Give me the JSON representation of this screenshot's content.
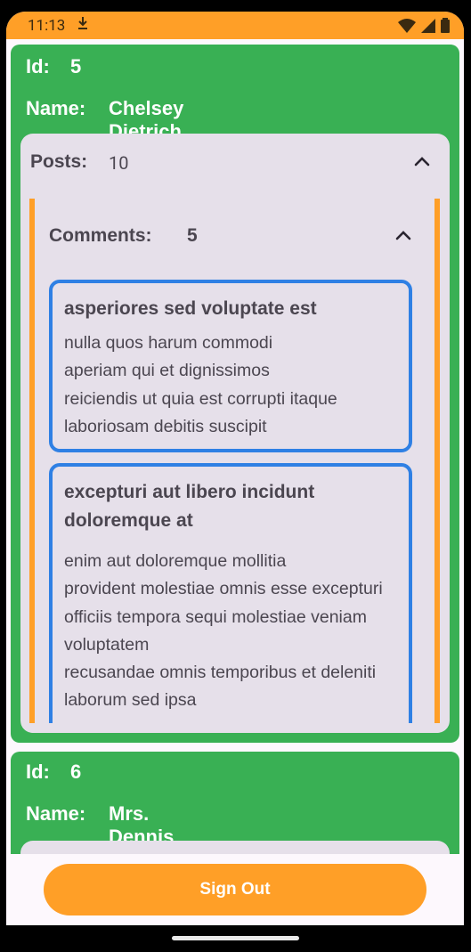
{
  "status": {
    "time": "11:13"
  },
  "users": [
    {
      "id_label": "Id:",
      "id": "5",
      "name_label": "Name:",
      "name": "Chelsey Dietrich",
      "posts_label": "Posts:",
      "posts_count": "10",
      "comments_label": "Comments:",
      "comments_count": "5",
      "comments": [
        {
          "title": "asperiores sed voluptate est",
          "body": "nulla quos harum commodi\naperiam qui et dignissimos\nreiciendis ut quia est corrupti itaque\nlaboriosam debitis suscipit"
        },
        {
          "title": "excepturi aut libero incidunt doloremque at",
          "body": "enim aut doloremque mollitia\nprovident molestiae omnis esse excepturi\nofficiis tempora sequi molestiae veniam voluptatem\nrecusandae omnis temporibus et deleniti laborum sed ipsa"
        }
      ]
    },
    {
      "id_label": "Id:",
      "id": "6",
      "name_label": "Name:",
      "name": "Mrs. Dennis Schulist"
    }
  ],
  "sign_out_label": "Sign Out",
  "colors": {
    "accent": "#ff9f27",
    "card_green": "#39b054",
    "comment_border": "#2f80e4",
    "panel": "#e6e0ea"
  }
}
